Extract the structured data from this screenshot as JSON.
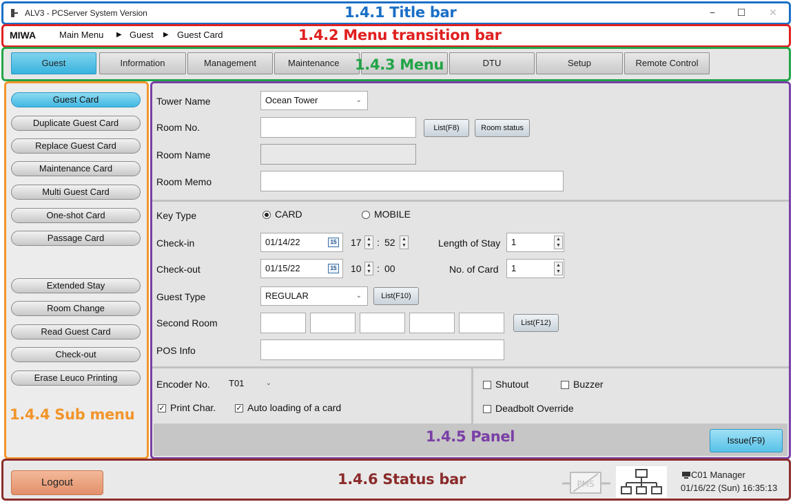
{
  "colors": {
    "title_frame": "#1a6fc6",
    "crumb_frame": "#e02020",
    "menu_frame": "#22a447",
    "submenu_frame": "#f2952b",
    "panel_frame": "#7a3fa6",
    "status_frame": "#8b2b2b",
    "active_blue": "#39b3de",
    "logout_orange": "#e38f6a"
  },
  "annotations": {
    "title_bar": "1.4.1 Title bar",
    "transition_bar": "1.4.2 Menu transition bar",
    "menu": "1.4.3 Menu",
    "sub_menu": "1.4.4 Sub menu",
    "panel": "1.4.5 Panel",
    "status_bar": "1.4.6 Status bar"
  },
  "window": {
    "title": "ALV3 - PCServer System Version",
    "minimize_icon": "minimize-icon",
    "maximize_icon": "maximize-icon",
    "close_icon": "close-icon",
    "minimize": "−",
    "maximize": "☐",
    "close": "✕"
  },
  "breadcrumb": {
    "brand": "MIWA",
    "items": [
      "Main Menu",
      "Guest",
      "Guest Card"
    ],
    "separator": "▶"
  },
  "menu": {
    "tabs": [
      "Guest",
      "Information",
      "Management",
      "Maintenance",
      "",
      "DTU",
      "Setup",
      "Remote Control"
    ],
    "active": "Guest"
  },
  "submenu": {
    "items": [
      "Guest Card",
      "Duplicate Guest Card",
      "Replace Guest Card",
      "Maintenance Card",
      "Multi Guest Card",
      "One-shot Card",
      "Passage Card",
      "Extended Stay",
      "Room Change",
      "Read Guest Card",
      "Check-out",
      "Erase Leuco Printing"
    ],
    "active": "Guest Card"
  },
  "panel": {
    "tower_name": {
      "label": "Tower Name",
      "value": "Ocean Tower"
    },
    "room_no": {
      "label": "Room No.",
      "value": "",
      "list_button": "List(F8)",
      "status_button": "Room status"
    },
    "room_name": {
      "label": "Room Name",
      "value": ""
    },
    "room_memo": {
      "label": "Room Memo",
      "value": ""
    },
    "key_type": {
      "label": "Key Type",
      "option_card": "CARD",
      "option_mobile": "MOBILE",
      "selected": "CARD"
    },
    "check_in": {
      "label": "Check-in",
      "date": "01/14/22",
      "hour": "17",
      "minute": "52",
      "colon": ":",
      "calendar_day": "15"
    },
    "check_out": {
      "label": "Check-out",
      "date": "01/15/22",
      "hour": "10",
      "minute": "00",
      "colon": ":",
      "calendar_day": "15"
    },
    "length_of_stay": {
      "label": "Length of Stay",
      "value": "1"
    },
    "no_of_card": {
      "label": "No. of Card",
      "value": "1"
    },
    "guest_type": {
      "label": "Guest Type",
      "value": "REGULAR",
      "list_button": "List(F10)"
    },
    "second_room": {
      "label": "Second Room",
      "list_button": "List(F12)"
    },
    "pos_info": {
      "label": "POS Info",
      "value": ""
    },
    "encoder": {
      "label": "Encoder No.",
      "value": "T01"
    },
    "print_char": {
      "label": "Print Char.",
      "checked": true
    },
    "auto_loading": {
      "label": "Auto loading of a card",
      "checked": true
    },
    "shutout": {
      "label": "Shutout",
      "checked": false
    },
    "buzzer": {
      "label": "Buzzer",
      "checked": false
    },
    "deadbolt_override": {
      "label": "Deadbolt Override",
      "checked": false
    },
    "issue_button": "Issue(F9)",
    "check_mark": "✓",
    "caret": "⌄"
  },
  "status": {
    "logout": "Logout",
    "pms_label": "PMS",
    "user": "C01 Manager",
    "datetime": "01/16/22 (Sun) 16:35:13"
  }
}
